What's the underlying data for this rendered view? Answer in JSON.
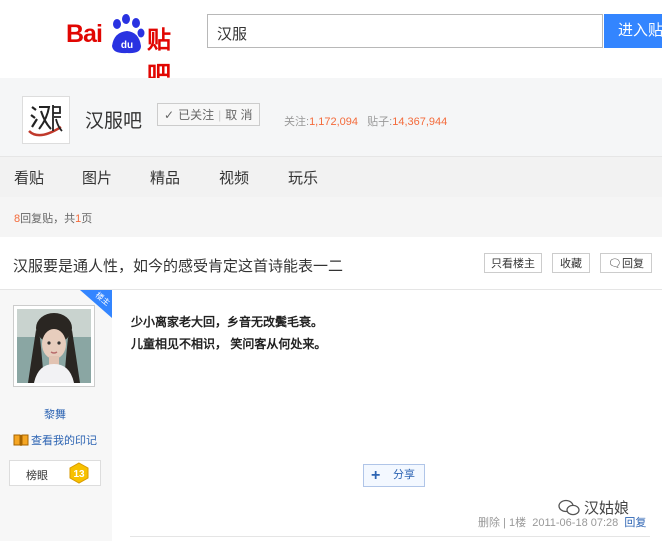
{
  "logo": {
    "bai": "Bai",
    "du": "du",
    "tieba": "贴吧"
  },
  "search": {
    "value": "汉服",
    "button": "进入贴吧"
  },
  "forum": {
    "name": "汉服吧",
    "follow_label": "已关注",
    "unfollow_label": "取 消",
    "follow_count_label": "关注:",
    "follow_count": "1,172,094",
    "post_count_label": "贴子:",
    "post_count": "14,367,944"
  },
  "nav": {
    "items": [
      "看贴",
      "图片",
      "精品",
      "视频",
      "玩乐"
    ]
  },
  "pager": {
    "count": "8",
    "mid": "回复贴，共",
    "pages": "1",
    "suffix": "页"
  },
  "thread": {
    "title": "汉服要是通人性，如今的感受肯定这首诗能表一二",
    "btn_only_lz": "只看楼主",
    "btn_fav": "收藏",
    "btn_reply": "回复"
  },
  "author": {
    "badge": "楼主",
    "name": "黎舞",
    "mark_label": "查看我的印记",
    "level_name": "榜眼",
    "level": "13"
  },
  "post": {
    "lines": [
      "少小离家老大回，乡音无改鬓毛衰。",
      "儿童相见不相识， 笑问客从何处来。"
    ],
    "share": "分享",
    "delete": "删除",
    "floor": "1楼",
    "time": "2011-06-18 07:28",
    "reply": "回复"
  },
  "watermark": "汉姑娘",
  "colors": {
    "brand_red": "#e10602",
    "brand_blue": "#2932e1",
    "link": "#2d64b3",
    "accent": "#f46b3b",
    "search_btn": "#3385ff"
  }
}
